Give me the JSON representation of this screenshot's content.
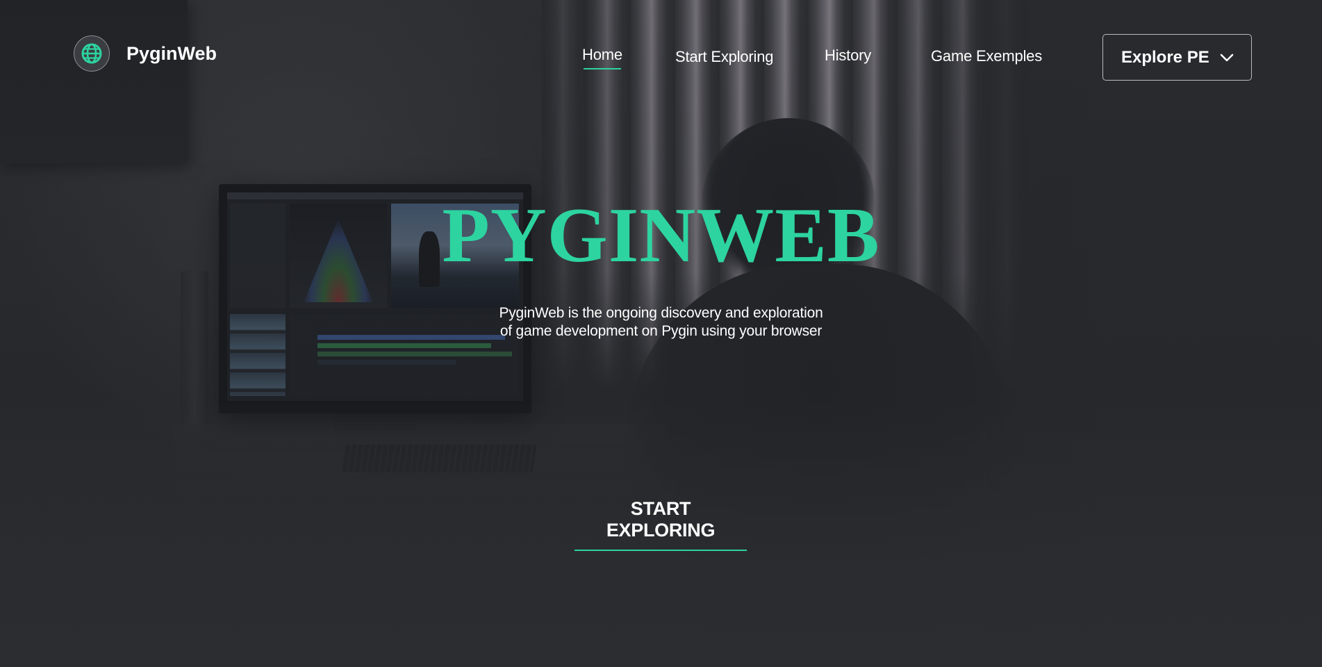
{
  "brand": {
    "name": "PyginWeb",
    "logo_icon": "globe-icon"
  },
  "nav": {
    "items": [
      {
        "label": "Home",
        "active": true
      },
      {
        "label": "Start Exploring",
        "active": false
      },
      {
        "label": "History",
        "active": false
      },
      {
        "label": "Game Exemples",
        "active": false
      }
    ]
  },
  "explore_button": {
    "label": "Explore PE",
    "icon": "chevron-down-icon"
  },
  "hero": {
    "title": "PYGINWEB",
    "subtitle_line1": "PyginWeb is the ongoing discovery and exploration",
    "subtitle_line2": "of game development on Pygin using your browser",
    "cta_label": "START EXPLORING"
  },
  "colors": {
    "accent": "#2dd4a0",
    "background": "#2a2c30",
    "text": "#ffffff"
  }
}
